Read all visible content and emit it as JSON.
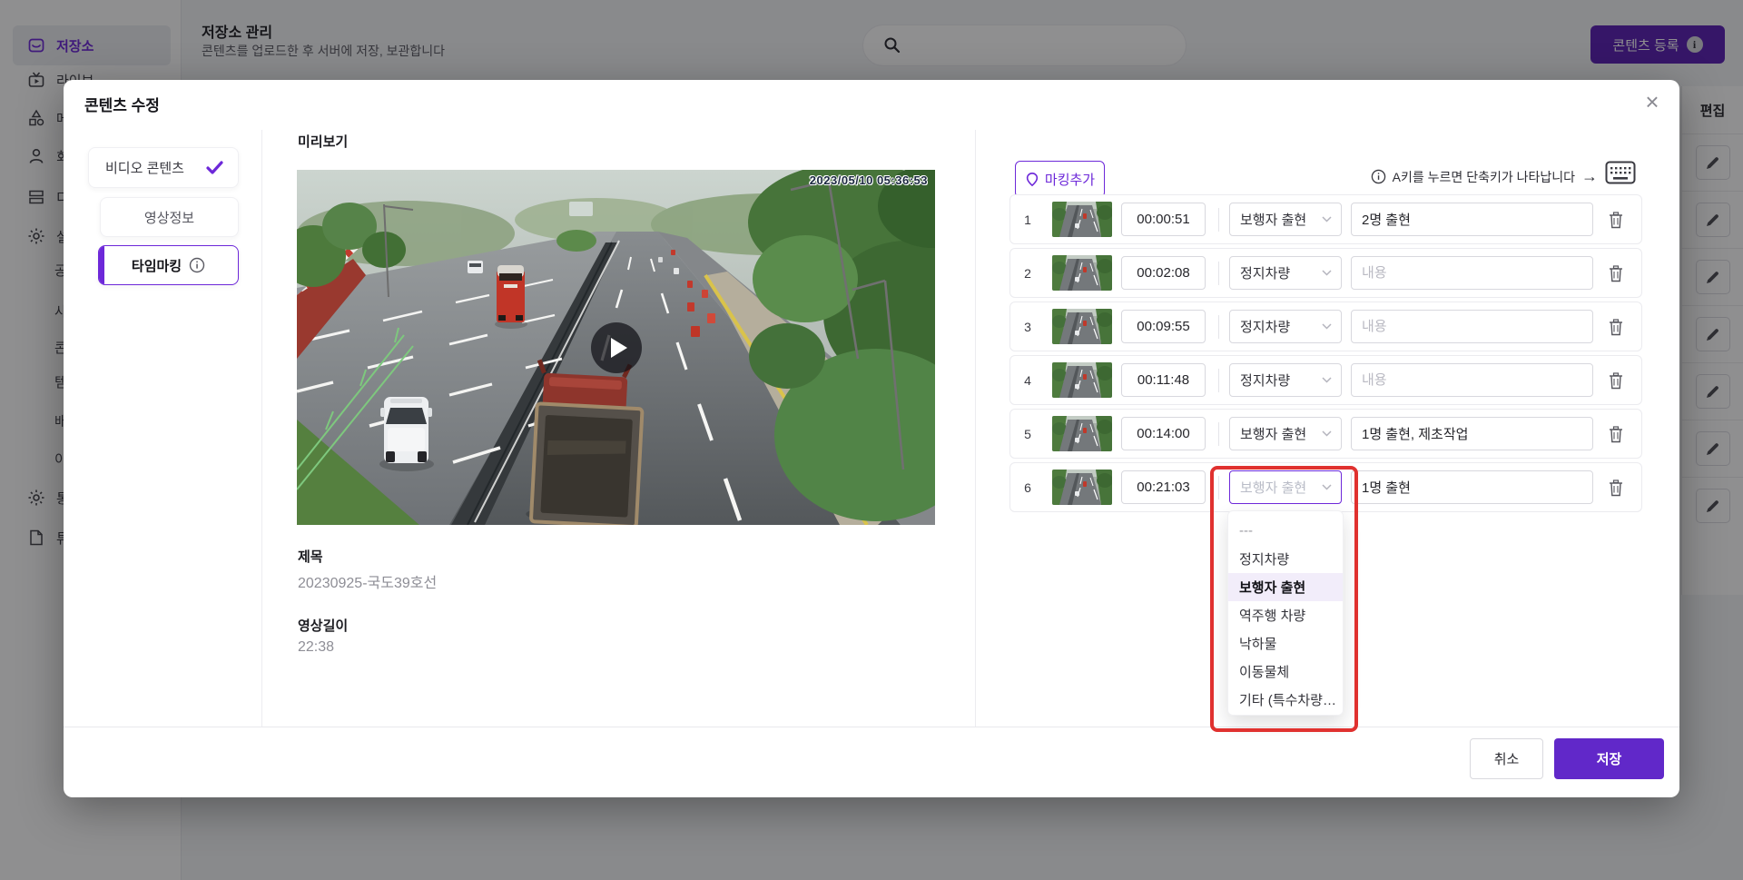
{
  "colors": {
    "accent": "#6d28d9",
    "save_button": "#6128c9",
    "register_button": "#5b21b6",
    "highlight_red": "#e0312f"
  },
  "page": {
    "sidebar": {
      "items": [
        {
          "label": "저장소",
          "icon": "storage-icon",
          "active": true
        },
        {
          "label": "라이브",
          "icon": "live-tv-icon"
        },
        {
          "label": "메",
          "icon": "shapes-icon"
        },
        {
          "label": "회",
          "icon": "user-icon"
        },
        {
          "label": "디",
          "icon": "layout-icon"
        },
        {
          "label": "설",
          "icon": "gear-icon"
        }
      ],
      "sub_items": [
        "공",
        "사",
        "콘",
        "템",
        "배",
        "이"
      ],
      "bottom_items": [
        {
          "label": "통",
          "icon": "gear-icon"
        },
        {
          "label": "튜",
          "icon": "note-icon"
        }
      ]
    },
    "header": {
      "title": "저장소 관리",
      "subtitle": "콘텐츠를 업로드한 후 서버에 저장, 보관합니다",
      "register_button": "콘텐츠 등록"
    },
    "edit_column": {
      "header": "편집",
      "pencil_rows": 7
    }
  },
  "modal": {
    "title": "콘텐츠 수정",
    "close": "×",
    "tabs": [
      {
        "label": "비디오 콘텐츠",
        "state": "done"
      },
      {
        "label": "영상정보",
        "state": "normal"
      },
      {
        "label": "타임마킹",
        "state": "active"
      }
    ],
    "preview": {
      "label": "미리보기",
      "video_timestamp": "2023/05/10 05:36:53",
      "title_label": "제목",
      "title_value": "20230925-국도39호선",
      "duration_label": "영상길이",
      "duration_value": "22:38"
    },
    "marking": {
      "add_button": "마킹추가",
      "hint_text": "A키를 누르면 단축키가 나타납니다",
      "hint_arrow": "→",
      "rows": [
        {
          "index": "1",
          "time": "00:00:51",
          "type": "보행자 출현",
          "note": "2명 출현",
          "note_placeholder": ""
        },
        {
          "index": "2",
          "time": "00:02:08",
          "type": "정지차량",
          "note": "",
          "note_placeholder": "내용"
        },
        {
          "index": "3",
          "time": "00:09:55",
          "type": "정지차량",
          "note": "",
          "note_placeholder": "내용"
        },
        {
          "index": "4",
          "time": "00:11:48",
          "type": "정지차량",
          "note": "",
          "note_placeholder": "내용"
        },
        {
          "index": "5",
          "time": "00:14:00",
          "type": "보행자 출현",
          "note": "1명 출현, 제초작업",
          "note_placeholder": ""
        },
        {
          "index": "6",
          "time": "00:21:03",
          "type": "보행자 출현",
          "note": "1명 출현",
          "note_placeholder": "",
          "focused": true
        }
      ],
      "dropdown": {
        "options": [
          "---",
          "정지차량",
          "보행자 출현",
          "역주행 차량",
          "낙하물",
          "이동물체",
          "기타 (특수차량…"
        ],
        "selected_index": 2
      }
    },
    "footer": {
      "cancel": "취소",
      "save": "저장"
    }
  }
}
